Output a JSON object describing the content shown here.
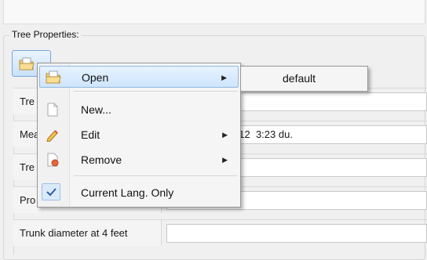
{
  "group": {
    "title": "Tree Properties:"
  },
  "toolbar": {
    "button_icon": "folder-icon"
  },
  "properties": [
    {
      "label": "Tre",
      "value": ""
    },
    {
      "label": "Mea",
      "value": "május    30, 2012  3:23 du."
    },
    {
      "label": "Tre",
      "value": ""
    },
    {
      "label": "Pro",
      "value": ""
    },
    {
      "label": "Trunk diameter at 4 feet",
      "value": ""
    }
  ],
  "menu": {
    "items": [
      {
        "label": "Open",
        "icon": "open-folder-icon",
        "has_submenu": true
      },
      {
        "label": "New...",
        "icon": "new-document-icon",
        "has_submenu": false
      },
      {
        "label": "Edit",
        "icon": "pencil-icon",
        "has_submenu": true
      },
      {
        "label": "Remove",
        "icon": "remove-document-icon",
        "has_submenu": true
      },
      {
        "label": "Current Lang. Only",
        "icon": "checkmark-icon",
        "checked": true
      }
    ]
  },
  "submenu": {
    "items": [
      {
        "label": "default"
      }
    ]
  },
  "colors": {
    "selection": "#cfe5fc",
    "selection_border": "#90b8e2",
    "accent": "#3a7bd5"
  }
}
